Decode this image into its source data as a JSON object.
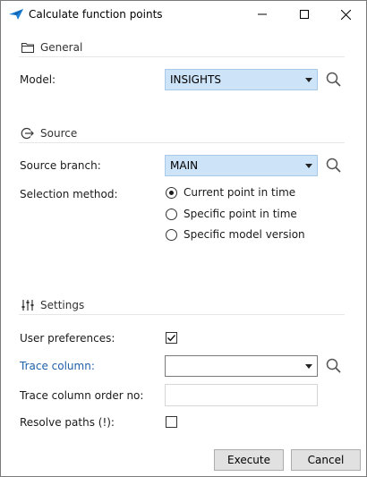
{
  "window": {
    "title": "Calculate function points",
    "icon": "app-arrow-icon",
    "controls": [
      "minimize-icon",
      "maximize-icon",
      "close-icon"
    ]
  },
  "sections": {
    "general": {
      "title": "General",
      "icon": "folder-icon"
    },
    "source": {
      "title": "Source",
      "icon": "source-arrow-icon"
    },
    "settings": {
      "title": "Settings",
      "icon": "sliders-icon"
    }
  },
  "model": {
    "label": "Model:",
    "value": "INSIGHTS"
  },
  "source_branch": {
    "label": "Source branch:",
    "value": "MAIN"
  },
  "selection_method": {
    "label": "Selection method:",
    "options": [
      "Current point in time",
      "Specific point in time",
      "Specific model version"
    ],
    "selected": "Current point in time"
  },
  "user_preferences": {
    "label": "User preferences:",
    "checked": true
  },
  "trace_column": {
    "label": "Trace column:",
    "value": ""
  },
  "trace_column_order": {
    "label": "Trace column order no:",
    "value": ""
  },
  "resolve_paths": {
    "label": "Resolve paths (!):",
    "checked": false
  },
  "buttons": {
    "execute": "Execute",
    "cancel": "Cancel"
  },
  "colors": {
    "accent": "#1f5fa8",
    "combo_highlight": "#cde3f7",
    "button_bg": "#e1e1e1"
  }
}
